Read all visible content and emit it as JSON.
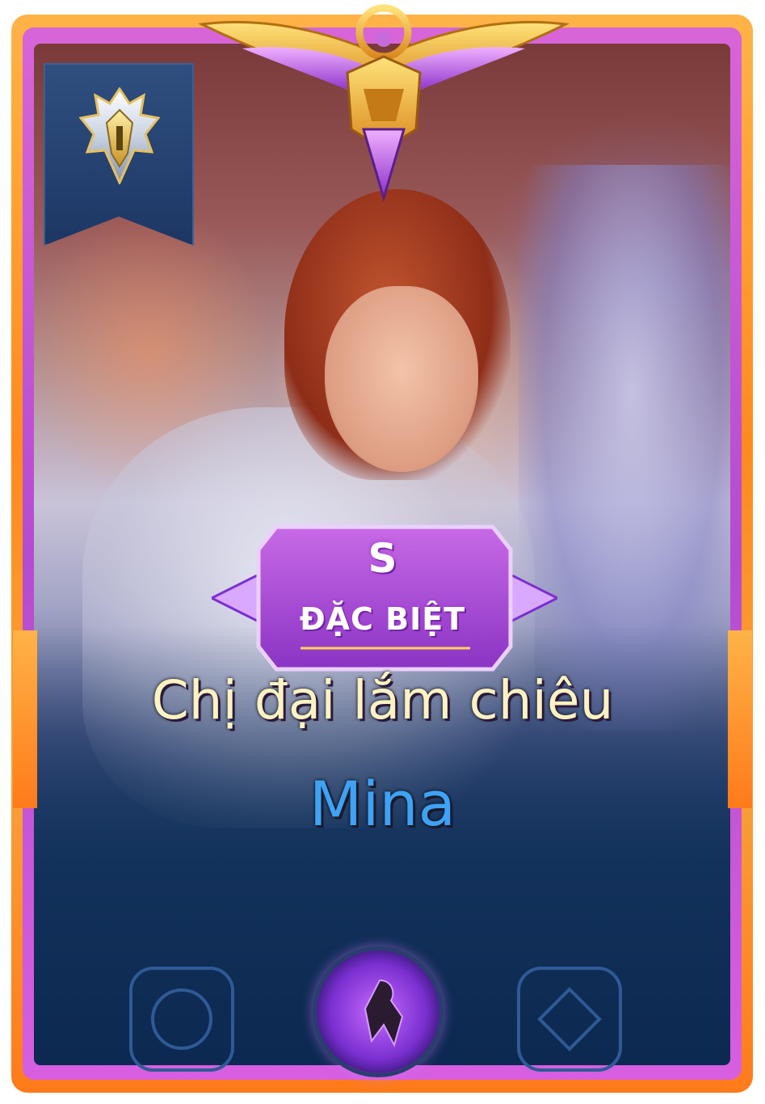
{
  "card": {
    "tier_letter": "S",
    "tier_label": "ĐẶC BIỆT",
    "skin_name": "Chị đại lắm chiêu",
    "hero_name": "Mina"
  },
  "icons": {
    "rank_badge": "rank-badge-icon",
    "crest": "winged-crest-icon",
    "skill": "skill-icon"
  },
  "colors": {
    "frame_orange": "#ff8a1e",
    "frame_purple": "#c257d6",
    "skin_name_text": "#fff2c2",
    "hero_name_text": "#3ea2f5",
    "tier_badge": "#a13bd6"
  }
}
